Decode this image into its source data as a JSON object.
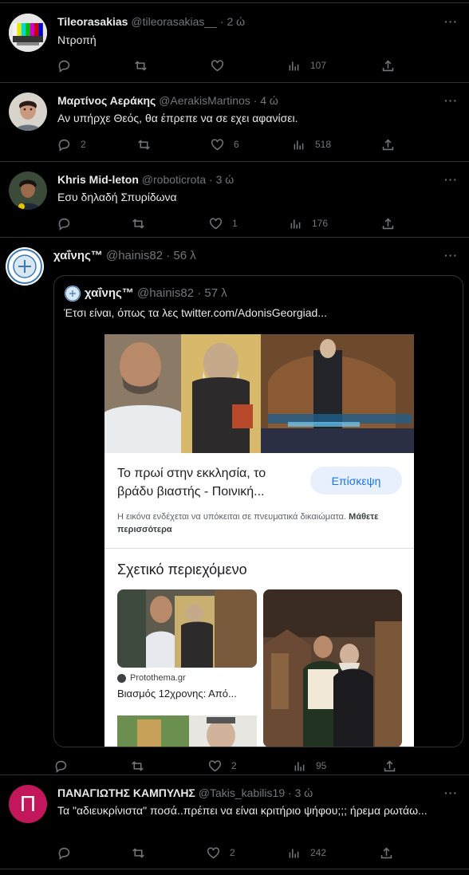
{
  "tweets": [
    {
      "name": "Tileorasakias",
      "handle": "@tileorasakias__",
      "time": "2 ώ",
      "text": "Ντροπή",
      "replies": "",
      "retweets": "",
      "likes": "",
      "views": "107"
    },
    {
      "name": "Μαρτίνος Αεράκης",
      "handle": "@AerakisMartinos",
      "time": "4 ώ",
      "text": "Αν υπήρχε Θεός, θα έπρεπε να σε εχει αφανίσει.",
      "replies": "2",
      "retweets": "",
      "likes": "6",
      "views": "518"
    },
    {
      "name": "Khris Mid-leton",
      "handle": "@roboticrota",
      "time": "3 ώ",
      "text": "Εσυ δηλαδή Σπυρίδωνα",
      "replies": "",
      "retweets": "",
      "likes": "1",
      "views": "176"
    },
    {
      "name": "χαΐνης™",
      "handle": "@hainis82",
      "time": "56 λ",
      "text": "",
      "replies": "",
      "retweets": "",
      "likes": "2",
      "views": "95"
    },
    {
      "name": "ΠΑΝΑΓΙΩΤΗΣ ΚΑΜΠΥΛΗΣ",
      "handle": "@Takis_kabilis19",
      "time": "3 ώ",
      "text": "Τα \"αδιευκρίνιστα\" ποσά..πρέπει να είναι κριτήριο ψήφου;;; ήρεμα ρωτάω...",
      "avatar_letter": "Π",
      "replies": "",
      "retweets": "",
      "likes": "2",
      "views": "242"
    }
  ],
  "quote": {
    "name": "χαΐνης™",
    "handle": "@hainis82",
    "time": "57 λ",
    "text": "Έτσι είναι, όπως τα λες",
    "link": "twitter.com/AdonisGeorgiad...",
    "card": {
      "headline": "Το πρωί στην εκκλησία, το βράδυ βιαστής - Ποινική...",
      "visit_button": "Επίσκεψη",
      "copyright_note": "Η εικόνα ενδέχεται να υπόκειται σε πνευματικά δικαιώματα.",
      "learn_more": "Μάθετε περισσότερα",
      "related_title": "Σχετικό περιεχόμενο",
      "related_source": "Protothema.gr",
      "related_caption": "Βιασμός 12χρονης: Από..."
    }
  },
  "colors": {
    "background": "#000000",
    "text": "#e7e9ea",
    "muted": "#71767b",
    "border": "#2f3336",
    "avatar_pink": "#c2185b",
    "visit_button_bg": "#e8f0fe",
    "visit_button_text": "#1a73e8"
  },
  "icons": [
    "reply-icon",
    "retweet-icon",
    "like-icon",
    "views-icon",
    "share-icon",
    "more-icon",
    "globe-icon"
  ]
}
